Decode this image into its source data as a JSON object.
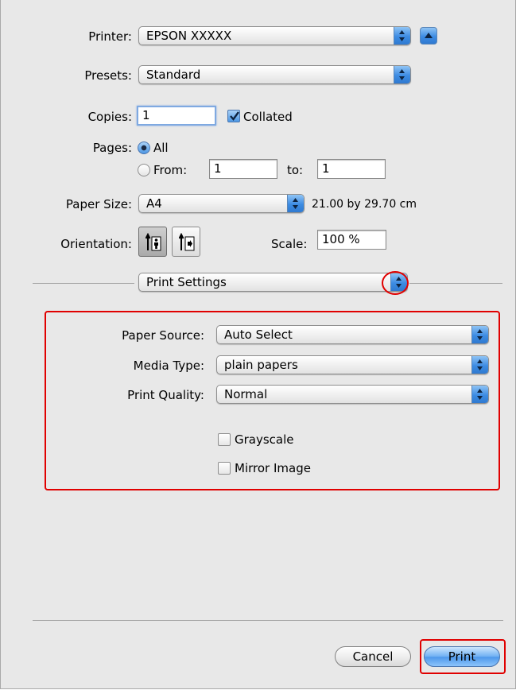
{
  "printer": {
    "label": "Printer:",
    "value": "EPSON XXXXX"
  },
  "presets": {
    "label": "Presets:",
    "value": "Standard"
  },
  "copies": {
    "label": "Copies:",
    "value": "1",
    "collated_label": "Collated",
    "collated_checked": true
  },
  "pages": {
    "label": "Pages:",
    "all_label": "All",
    "from_label": "From:",
    "from_value": "1",
    "to_label": "to:",
    "to_value": "1"
  },
  "paper_size": {
    "label": "Paper Size:",
    "value": "A4",
    "dimensions": "21.00 by 29.70 cm"
  },
  "orientation": {
    "label": "Orientation:",
    "portrait_icon": "portrait-icon",
    "landscape_icon": "landscape-icon"
  },
  "scale": {
    "label": "Scale:",
    "value": "100 %"
  },
  "section_popup": {
    "value": "Print Settings"
  },
  "print_settings": {
    "paper_source": {
      "label": "Paper Source:",
      "value": "Auto Select"
    },
    "media_type": {
      "label": "Media Type:",
      "value": "plain papers"
    },
    "print_quality": {
      "label": "Print Quality:",
      "value": "Normal"
    },
    "grayscale_label": "Grayscale",
    "mirror_label": "Mirror Image"
  },
  "buttons": {
    "cancel": "Cancel",
    "print": "Print"
  },
  "colors": {
    "highlight": "#e00000",
    "accent": "#3d8ce3"
  }
}
